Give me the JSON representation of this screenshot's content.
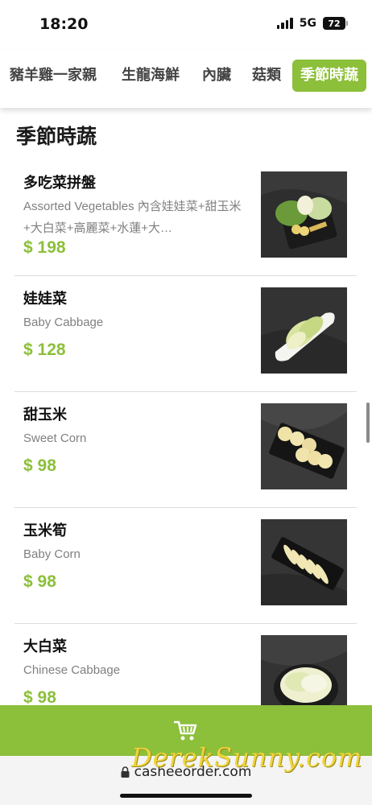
{
  "status_bar": {
    "time": "18:20",
    "network": "5G",
    "battery": "72"
  },
  "categories": [
    {
      "label": "豬羊雞一家親"
    },
    {
      "label": "生龍海鮮"
    },
    {
      "label": "內臟"
    },
    {
      "label": "菇類"
    },
    {
      "label": "季節時蔬"
    }
  ],
  "section": {
    "title": "季節時蔬"
  },
  "items": [
    {
      "name": "多吃菜拼盤",
      "desc": "Assorted Vegetables 內含娃娃菜+甜玉米+大白菜+高麗菜+水蓮+大…",
      "price": "$ 198",
      "image": "vegetable-platter-photo"
    },
    {
      "name": "娃娃菜",
      "desc": "Baby Cabbage",
      "price": "$ 128",
      "image": "baby-cabbage-photo"
    },
    {
      "name": "甜玉米",
      "desc": "Sweet Corn",
      "price": "$ 98",
      "image": "sweet-corn-photo"
    },
    {
      "name": "玉米筍",
      "desc": "Baby Corn",
      "price": "$ 98",
      "image": "baby-corn-photo"
    },
    {
      "name": "大白菜",
      "desc": "Chinese Cabbage",
      "price": "$ 98",
      "image": "chinese-cabbage-photo"
    }
  ],
  "cart": {
    "icon": "cart-icon"
  },
  "browser": {
    "url": "casheeorder.com"
  },
  "watermark": "DerekSunny.com",
  "colors": {
    "accent": "#8cbf3a",
    "text": "#1a1a1a",
    "muted": "#808080"
  }
}
